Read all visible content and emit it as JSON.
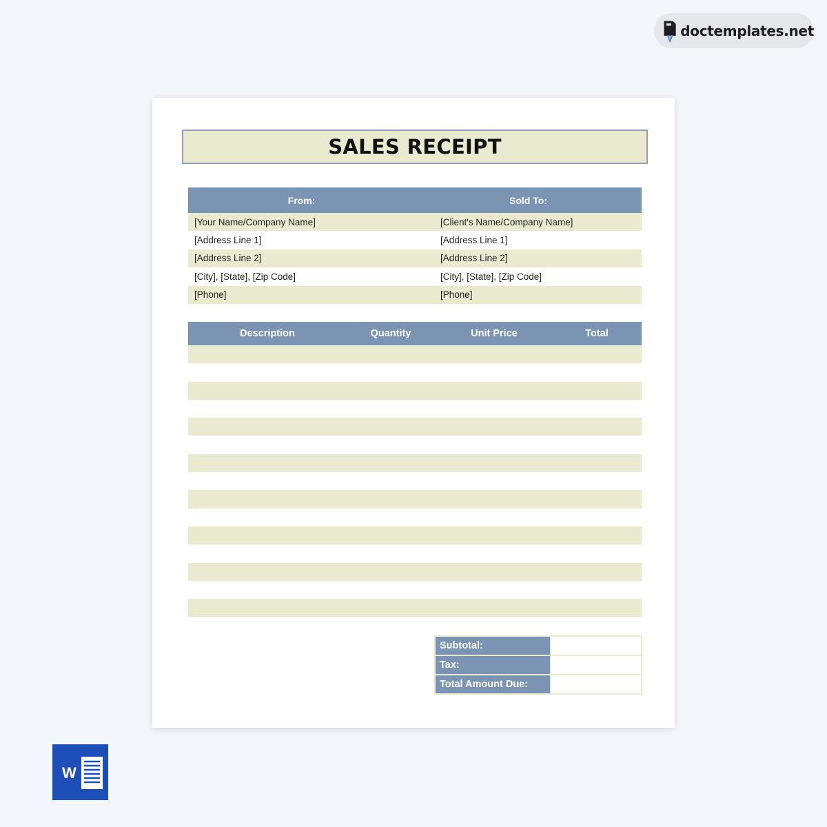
{
  "brand": {
    "name": "doctemplates.net",
    "icon": "pen-nib-logo-icon"
  },
  "document": {
    "title": "SALES RECEIPT",
    "party": {
      "headers": [
        "From:",
        "Sold To:"
      ],
      "rows": [
        [
          "[Your Name/Company Name]",
          "[Client's Name/Company Name]"
        ],
        [
          "[Address Line 1]",
          "[Address Line 1]"
        ],
        [
          "[Address Line 2]",
          "[Address Line 2]"
        ],
        [
          "[City], [State], [Zip Code]",
          "[City], [State], [Zip Code]"
        ],
        [
          "[Phone]",
          "[Phone]"
        ]
      ]
    },
    "items": {
      "headers": [
        "Description",
        "Quantity",
        "Unit Price",
        "Total"
      ],
      "row_count": 15
    },
    "totals": {
      "subtotal_label": "Subtotal:",
      "tax_label": "Tax:",
      "total_label": "Total Amount Due:",
      "subtotal_value": "",
      "tax_value": "",
      "total_value": ""
    }
  },
  "file_type_icon": "word-icon",
  "colors": {
    "header_blue": "#7b94b3",
    "row_beige": "#eaead0",
    "word_blue": "#1e4fb8"
  }
}
